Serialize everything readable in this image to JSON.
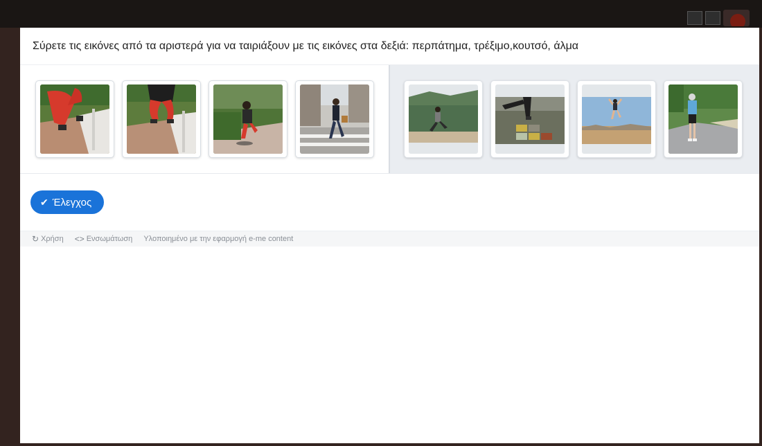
{
  "instruction": "Σύρετε τις εικόνες από τα αριστερά για να ταιριάξουν με τις εικόνες στα δεξιά: περπάτημα, τρέξιμο,κουτσό, άλμα",
  "check_button": {
    "label": "Έλεγχος",
    "icon": "check-icon"
  },
  "footer": {
    "usage_label": "Χρήση",
    "usage_icon": "refresh-icon",
    "embed_label": "Ενσωμάτωση",
    "embed_icon": "code-icon",
    "credit": "Υλοποιημένο με την εφαρμογή e-me content"
  },
  "colors": {
    "accent": "#1a73d9",
    "drop_panel_bg": "#eaedf1"
  },
  "draggable_images": [
    {
      "id": "drag-1",
      "depicts": "legs-red-leggings-stairs"
    },
    {
      "id": "drag-2",
      "depicts": "person-jumping-off-step"
    },
    {
      "id": "drag-3",
      "depicts": "person-hopping-garden"
    },
    {
      "id": "drag-4",
      "depicts": "woman-walking-crosswalk"
    }
  ],
  "target_images": [
    {
      "id": "target-1",
      "depicts": "woman-running-hills"
    },
    {
      "id": "target-2",
      "depicts": "hopscotch-court"
    },
    {
      "id": "target-3",
      "depicts": "person-jumping-beach"
    },
    {
      "id": "target-4",
      "depicts": "elderly-woman-walking-road"
    }
  ]
}
